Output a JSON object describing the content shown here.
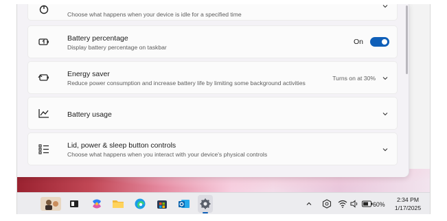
{
  "settings": {
    "top_card": {
      "desc": "Choose what happens when your device is idle for a specified time",
      "icon": "power-sleep-icon"
    },
    "battery_percentage": {
      "title": "Battery percentage",
      "desc": "Display battery percentage on taskbar",
      "toggle_label": "On",
      "toggle_on": true,
      "icon": "battery-percent-icon"
    },
    "energy_saver": {
      "title": "Energy saver",
      "desc": "Reduce power consumption and increase battery life by limiting some background activities",
      "status": "Turns on at 30%",
      "icon": "energy-saver-icon"
    },
    "battery_usage": {
      "title": "Battery usage",
      "icon": "chart-line-icon"
    },
    "lid_power": {
      "title": "Lid, power & sleep button controls",
      "desc": "Choose what happens when you interact with your device's physical controls",
      "icon": "list-icon"
    }
  },
  "taskbar": {
    "apps": [
      "widgets-icon",
      "task-view-icon",
      "copilot-icon",
      "file-explorer-icon",
      "edge-icon",
      "microsoft-store-icon",
      "outlook-icon",
      "settings-icon"
    ],
    "active_app": "settings-icon",
    "battery_percent": "60%",
    "time": "2:34 PM",
    "date": "1/17/2025"
  },
  "colors": {
    "accent": "#0f5fb8"
  }
}
